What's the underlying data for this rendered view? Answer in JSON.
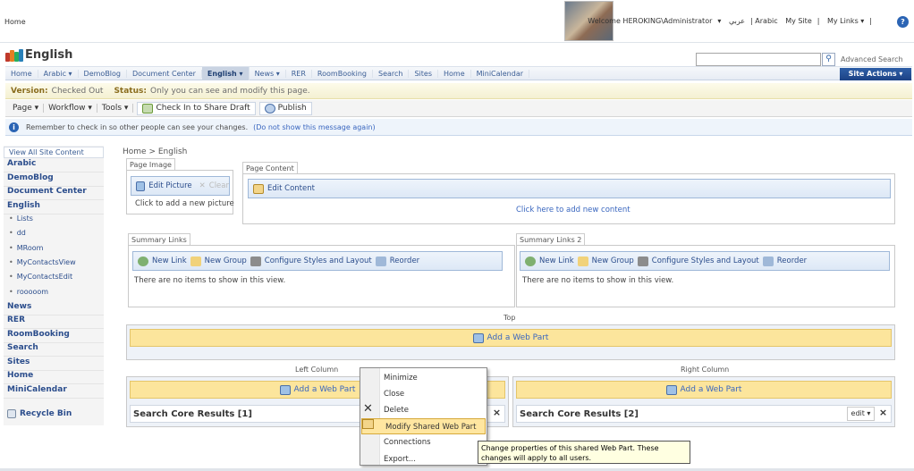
{
  "topbar": {
    "home_link": "Home",
    "welcome_user": "Welcome HEROKING\\Administrator",
    "welcome_arrow": "▾",
    "arabic_native": "عربي",
    "arabic": "| Arabic",
    "my_site": "My Site",
    "sep1": "|",
    "my_links": "My Links ▾",
    "sep2": "|",
    "help": "?"
  },
  "site": {
    "title": "English",
    "advanced_search": "Advanced Search",
    "search_placeholder": "",
    "site_actions": "Site Actions ▾"
  },
  "topnav": [
    {
      "label": "Home",
      "selected": false
    },
    {
      "label": "Arabic ▾",
      "selected": false
    },
    {
      "label": "DemoBlog",
      "selected": false
    },
    {
      "label": "Document Center",
      "selected": false
    },
    {
      "label": "English ▾",
      "selected": true
    },
    {
      "label": "News ▾",
      "selected": false
    },
    {
      "label": "RER",
      "selected": false
    },
    {
      "label": "RoomBooking",
      "selected": false
    },
    {
      "label": "Search",
      "selected": false
    },
    {
      "label": "Sites",
      "selected": false
    },
    {
      "label": "Home",
      "selected": false
    },
    {
      "label": "MiniCalendar",
      "selected": false
    }
  ],
  "status": {
    "version_label": "Version:",
    "version_value": "Checked Out",
    "status_label": "Status:",
    "status_value": "Only you can see and modify this page."
  },
  "toolbar": {
    "page": "Page ▾",
    "workflow": "Workflow ▾",
    "tools": "Tools ▾",
    "check_in": "Check In to Share Draft",
    "publish": "Publish"
  },
  "message": {
    "text": "Remember to check in so other people can see your changes.",
    "dismiss": "(Do not show this message again)"
  },
  "leftnav": {
    "view_all": "View All Site Content",
    "items": [
      {
        "label": "Arabic",
        "type": "heading"
      },
      {
        "label": "DemoBlog",
        "type": "heading"
      },
      {
        "label": "Document Center",
        "type": "heading"
      },
      {
        "label": "English",
        "type": "heading"
      },
      {
        "label": "Lists",
        "type": "sub"
      },
      {
        "label": "dd",
        "type": "sub"
      },
      {
        "label": "MRoom",
        "type": "sub"
      },
      {
        "label": "MyContactsView",
        "type": "sub"
      },
      {
        "label": "MyContactsEdit",
        "type": "sub"
      },
      {
        "label": "rooooom",
        "type": "sub"
      },
      {
        "label": "News",
        "type": "heading"
      },
      {
        "label": "RER",
        "type": "heading"
      },
      {
        "label": "RoomBooking",
        "type": "heading"
      },
      {
        "label": "Search",
        "type": "heading"
      },
      {
        "label": "Sites",
        "type": "heading"
      },
      {
        "label": "Home",
        "type": "heading"
      },
      {
        "label": "MiniCalendar",
        "type": "heading"
      }
    ],
    "recycle_bin": "Recycle Bin"
  },
  "breadcrumb": "Home > English",
  "page_image": {
    "label": "Page Image",
    "edit_picture": "Edit Picture",
    "clear": "Clear",
    "click_to_add": "Click to add a new picture"
  },
  "page_content": {
    "label": "Page Content",
    "edit_content": "Edit Content",
    "click_to_add": "Click here to add new content"
  },
  "summary1": {
    "label": "Summary Links",
    "new_link": "New Link",
    "new_group": "New Group",
    "configure": "Configure Styles and Layout",
    "reorder": "Reorder",
    "empty": "There are no items to show in this view."
  },
  "summary2": {
    "label": "Summary Links 2",
    "new_link": "New Link",
    "new_group": "New Group",
    "configure": "Configure Styles and Layout",
    "reorder": "Reorder",
    "empty": "There are no items to show in this view."
  },
  "zones": {
    "top": "Top",
    "left": "Left Column",
    "right": "Right Column",
    "add_web_part": "Add a Web Part"
  },
  "webparts": {
    "left_title": "Search Core Results [1]",
    "right_title": "Search Core Results [2]",
    "edit": "edit ▾",
    "close": "×"
  },
  "context_menu": {
    "items": [
      "Minimize",
      "Close",
      "Delete",
      "Modify Shared Web Part",
      "Connections",
      "Export..."
    ],
    "highlighted": "Modify Shared Web Part"
  },
  "tooltip": "Change properties of this shared Web Part. These changes will apply to all users.",
  "colors": {
    "accent": "#2b64b4",
    "add_web_part_bg": "#fce59c",
    "status_bg": "#fdfbea"
  }
}
